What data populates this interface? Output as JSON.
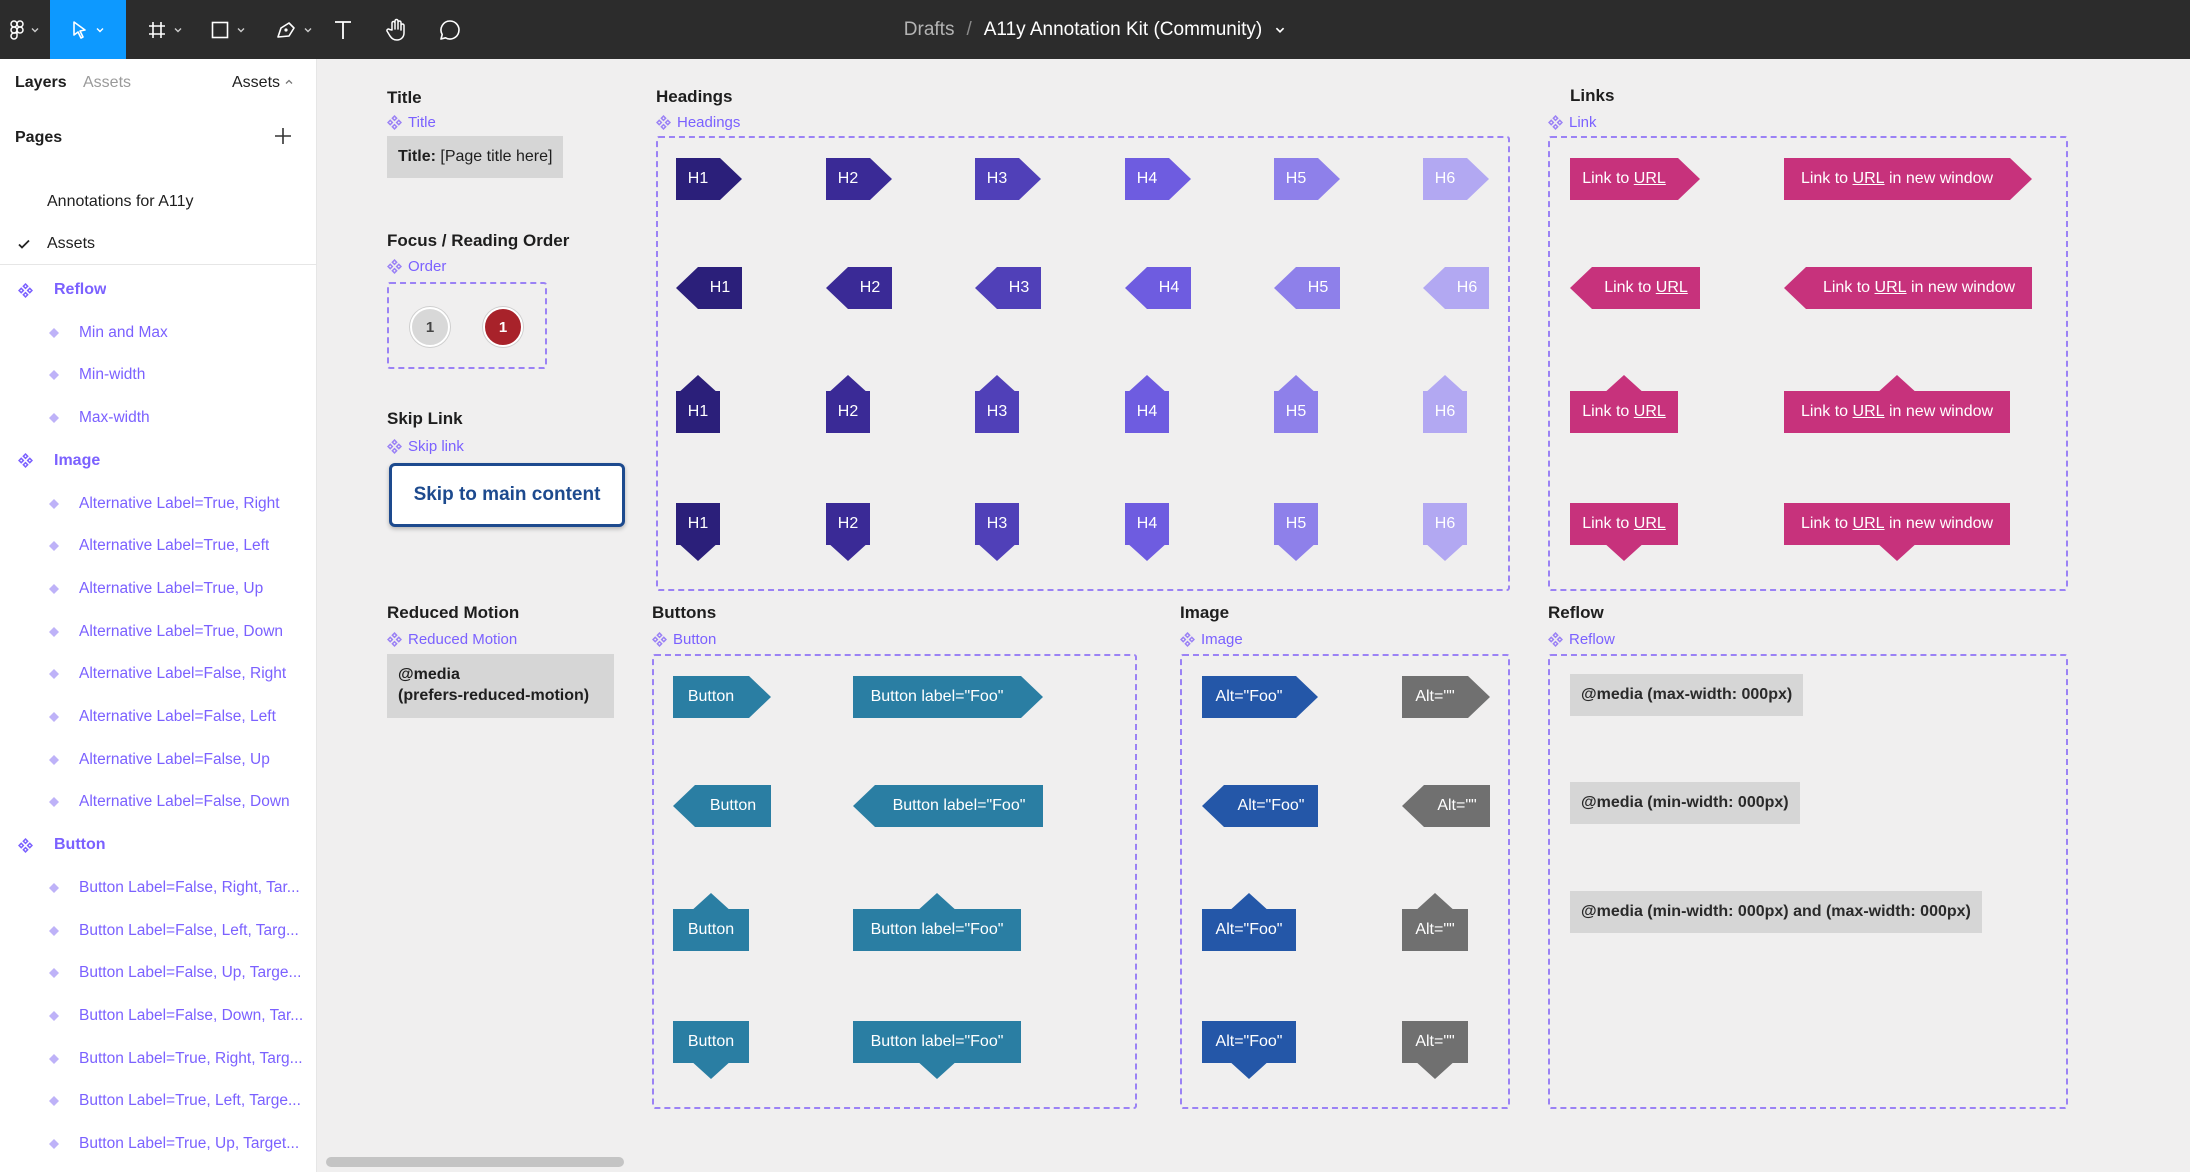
{
  "toolbar": {
    "tools": [
      {
        "name": "main-menu",
        "active": false
      },
      {
        "name": "move-tool",
        "active": true
      },
      {
        "name": "frame-tool",
        "active": false
      },
      {
        "name": "shape-tool",
        "active": false
      },
      {
        "name": "pen-tool",
        "active": false
      },
      {
        "name": "text-tool",
        "active": false
      },
      {
        "name": "hand-tool",
        "active": false
      },
      {
        "name": "comment-tool",
        "active": false
      }
    ],
    "breadcrumb": "Drafts",
    "separator": "/",
    "document_name": "A11y Annotation Kit (Community)"
  },
  "sidebar": {
    "tabs": {
      "layers": "Layers",
      "assets": "Assets",
      "assets_menu": "Assets"
    },
    "pages_heading": "Pages",
    "pages": [
      {
        "label": "Annotations for A11y",
        "current": false
      },
      {
        "label": "Assets",
        "current": true
      }
    ],
    "layers": [
      {
        "label": "Reflow",
        "kind": "component"
      },
      {
        "label": "Min and Max",
        "kind": "variant"
      },
      {
        "label": "Min-width",
        "kind": "variant"
      },
      {
        "label": "Max-width",
        "kind": "variant"
      },
      {
        "label": "Image",
        "kind": "component"
      },
      {
        "label": "Alternative Label=True, Right",
        "kind": "variant"
      },
      {
        "label": "Alternative Label=True, Left",
        "kind": "variant"
      },
      {
        "label": "Alternative Label=True, Up",
        "kind": "variant"
      },
      {
        "label": "Alternative Label=True, Down",
        "kind": "variant"
      },
      {
        "label": "Alternative Label=False, Right",
        "kind": "variant"
      },
      {
        "label": "Alternative Label=False, Left",
        "kind": "variant"
      },
      {
        "label": "Alternative Label=False, Up",
        "kind": "variant"
      },
      {
        "label": "Alternative Label=False, Down",
        "kind": "variant"
      },
      {
        "label": "Button",
        "kind": "component"
      },
      {
        "label": "Button Label=False, Right, Tar...",
        "kind": "variant"
      },
      {
        "label": "Button Label=False, Left, Targ...",
        "kind": "variant"
      },
      {
        "label": "Button Label=False, Up, Targe...",
        "kind": "variant"
      },
      {
        "label": "Button Label=False, Down, Tar...",
        "kind": "variant"
      },
      {
        "label": "Button Label=True, Right, Targ...",
        "kind": "variant"
      },
      {
        "label": "Button Label=True, Left, Targe...",
        "kind": "variant"
      },
      {
        "label": "Button Label=True, Up, Target...",
        "kind": "variant"
      }
    ]
  },
  "canvas": {
    "colors": {
      "h1": "#2b1f7a",
      "h2": "#3a2a96",
      "h3": "#5040b8",
      "h4": "#6e5ce0",
      "h5": "#8e80ea",
      "h6": "#b2a8f2",
      "link": "#c7327c",
      "button": "#2a7ea3",
      "image_alt": "#2457a8",
      "image_empty": "#707070",
      "frame_border": "#9b82f5",
      "order_red": "#a8222a"
    },
    "title_section": {
      "heading": "Title",
      "component": "Title",
      "box_bold": "Title:",
      "box_text": "[Page title here]"
    },
    "order_section": {
      "heading": "Focus / Reading Order",
      "component": "Order",
      "badges": [
        "1",
        "1"
      ]
    },
    "skip_section": {
      "heading": "Skip Link",
      "component": "Skip link",
      "button": "Skip to main content"
    },
    "motion_section": {
      "heading": "Reduced Motion",
      "component": "Reduced Motion",
      "line1": "@media",
      "line2": "(prefers-reduced-motion)"
    },
    "headings_section": {
      "heading": "Headings",
      "component": "Headings",
      "levels": [
        "H1",
        "H2",
        "H3",
        "H4",
        "H5",
        "H6"
      ]
    },
    "links_section": {
      "heading": "Links",
      "component": "Link",
      "link_pre": "Link to ",
      "link_url": "URL",
      "link_post": " in new window"
    },
    "buttons_section": {
      "heading": "Buttons",
      "component": "Button",
      "short": "Button",
      "long": "Button label=\"Foo\""
    },
    "image_section": {
      "heading": "Image",
      "component": "Image",
      "alt": "Alt=\"Foo\"",
      "empty": "Alt=\"\""
    },
    "reflow_section": {
      "heading": "Reflow",
      "component": "Reflow",
      "queries": [
        "@media (max-width: 000px)",
        "@media (min-width: 000px)",
        "@media (min-width: 000px) and (max-width: 000px)"
      ]
    }
  }
}
